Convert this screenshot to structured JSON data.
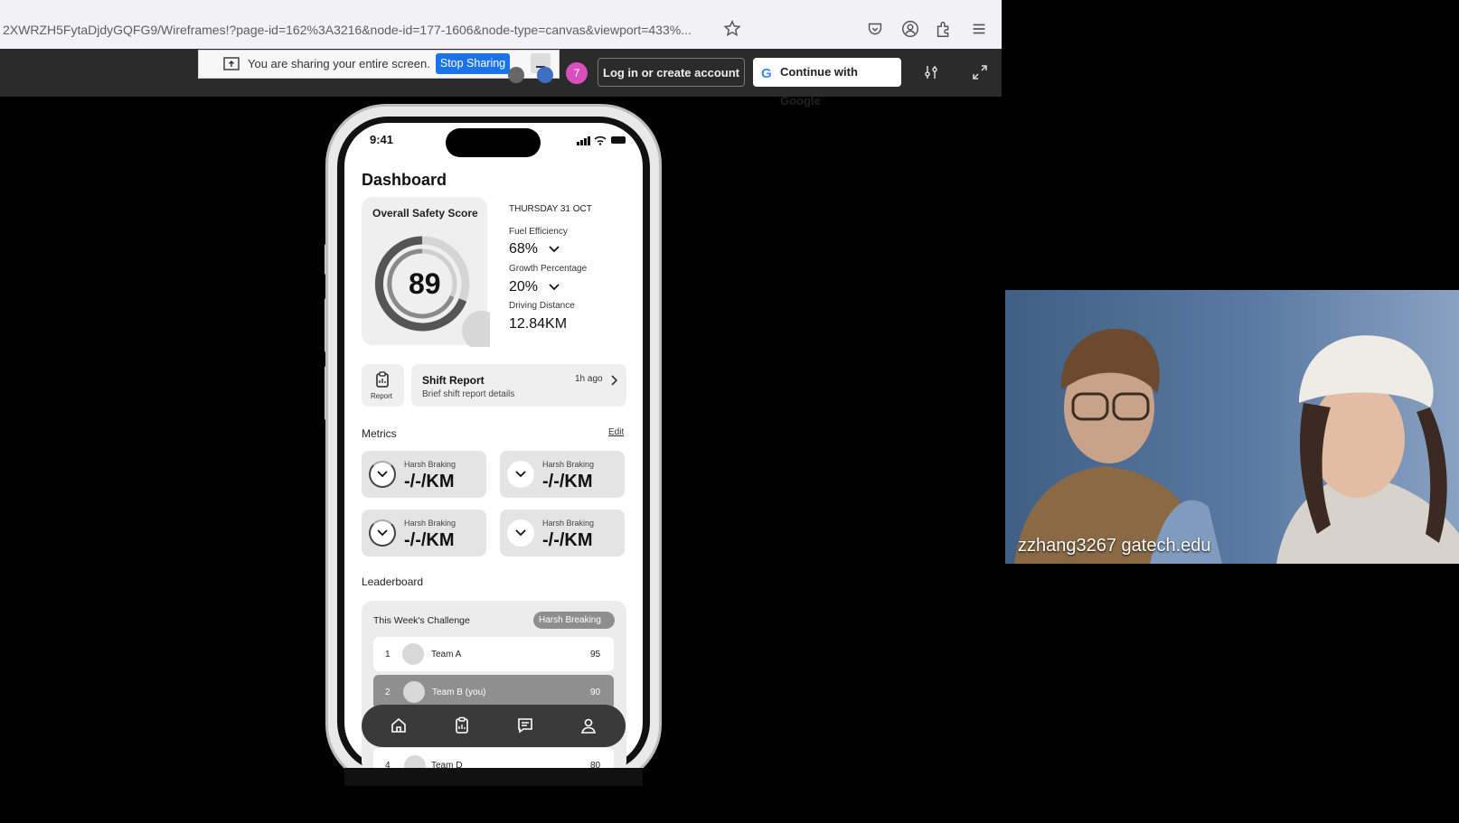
{
  "browser": {
    "url": "2XWRZH5FytaDjdyGQFG9/Wireframes!?page-id=162%3A3216&node-id=177-1606&node-type=canvas&viewport=433%..."
  },
  "share_banner": {
    "message": "You are sharing your entire screen.",
    "stop_label": "Stop Sharing",
    "minimize_label": "–"
  },
  "toolbar": {
    "avatar_label": "7",
    "login_label": "Log in or create account",
    "google_label": "Continue with Google"
  },
  "phone": {
    "status_time": "9:41",
    "title": "Dashboard",
    "safety": {
      "label": "Overall Safety Score",
      "score": "89"
    },
    "date": "THURSDAY 31 OCT",
    "stats": [
      {
        "label": "Fuel Efficiency",
        "value": "68%"
      },
      {
        "label": "Growth Percentage",
        "value": "20%"
      },
      {
        "label": "Driving Distance",
        "value": "12.84KM"
      }
    ],
    "report": {
      "icon_label": "Report",
      "title": "Shift Report",
      "subtitle": "Brief shift report details",
      "time": "1h ago"
    },
    "metrics": {
      "title": "Metrics",
      "edit_label": "Edit",
      "items": [
        {
          "label": "Harsh Braking",
          "value": "-/-/KM"
        },
        {
          "label": "Harsh Braking",
          "value": "-/-/KM"
        },
        {
          "label": "Harsh Braking",
          "value": "-/-/KM"
        },
        {
          "label": "Harsh Braking",
          "value": "-/-/KM"
        }
      ]
    },
    "leaderboard": {
      "title": "Leaderboard",
      "challenge": "This Week's Challenge",
      "tag": "Harsh Breaking",
      "rows": [
        {
          "rank": "1",
          "team": "Team A",
          "score": "95"
        },
        {
          "rank": "2",
          "team": "Team B (you)",
          "score": "90"
        },
        {
          "rank": "4",
          "team": "Team D",
          "score": "80"
        }
      ]
    }
  },
  "video": {
    "participant": "zzhang3267 gatech.edu"
  },
  "colors": {
    "stop_button": "#1a73e8",
    "avatar": "#d94fbf"
  }
}
